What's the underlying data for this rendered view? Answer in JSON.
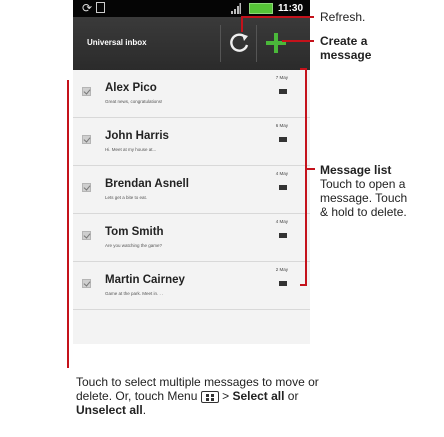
{
  "statusbar": {
    "time": "11:30"
  },
  "actionbar": {
    "title": "Universal inbox"
  },
  "messages": [
    {
      "name": "Alex Pico",
      "snippet": "Great news, congratulations!",
      "date": "7 May"
    },
    {
      "name": "John Harris",
      "snippet": "Hi. Meet at my house at...",
      "date": "6 May"
    },
    {
      "name": "Brendan Asnell",
      "snippet": "Lets get a bite to eat.",
      "date": "4 May"
    },
    {
      "name": "Tom Smith",
      "snippet": "Are you watching the game?",
      "date": "4 May"
    },
    {
      "name": "Martin Cairney",
      "snippet": "Game at the park. Meet in. . .",
      "date": "2 May"
    }
  ],
  "annotations": {
    "refresh": "Refresh.",
    "create_line1": "Create a",
    "create_line2": "message",
    "list_title": "Message list",
    "list_line1": "Touch to open a",
    "list_line2": "message. Touch",
    "list_line3": "& hold to delete.",
    "bottom_line1": "Touch to select multiple messages to move or",
    "bottom_line2a": "delete. Or, touch Menu",
    "bottom_line2b": "> ",
    "bottom_select_all": "Select all",
    "bottom_or": " or",
    "bottom_unselect_all": "Unselect all",
    "bottom_period": "."
  },
  "colors": {
    "callout": "#c4121b",
    "battery": "#56c437",
    "actionbar": "#2f2f2f"
  },
  "icons": [
    "refresh-icon",
    "compose-icon",
    "menu-key-icon",
    "envelope-icon",
    "checkbox-icon"
  ]
}
